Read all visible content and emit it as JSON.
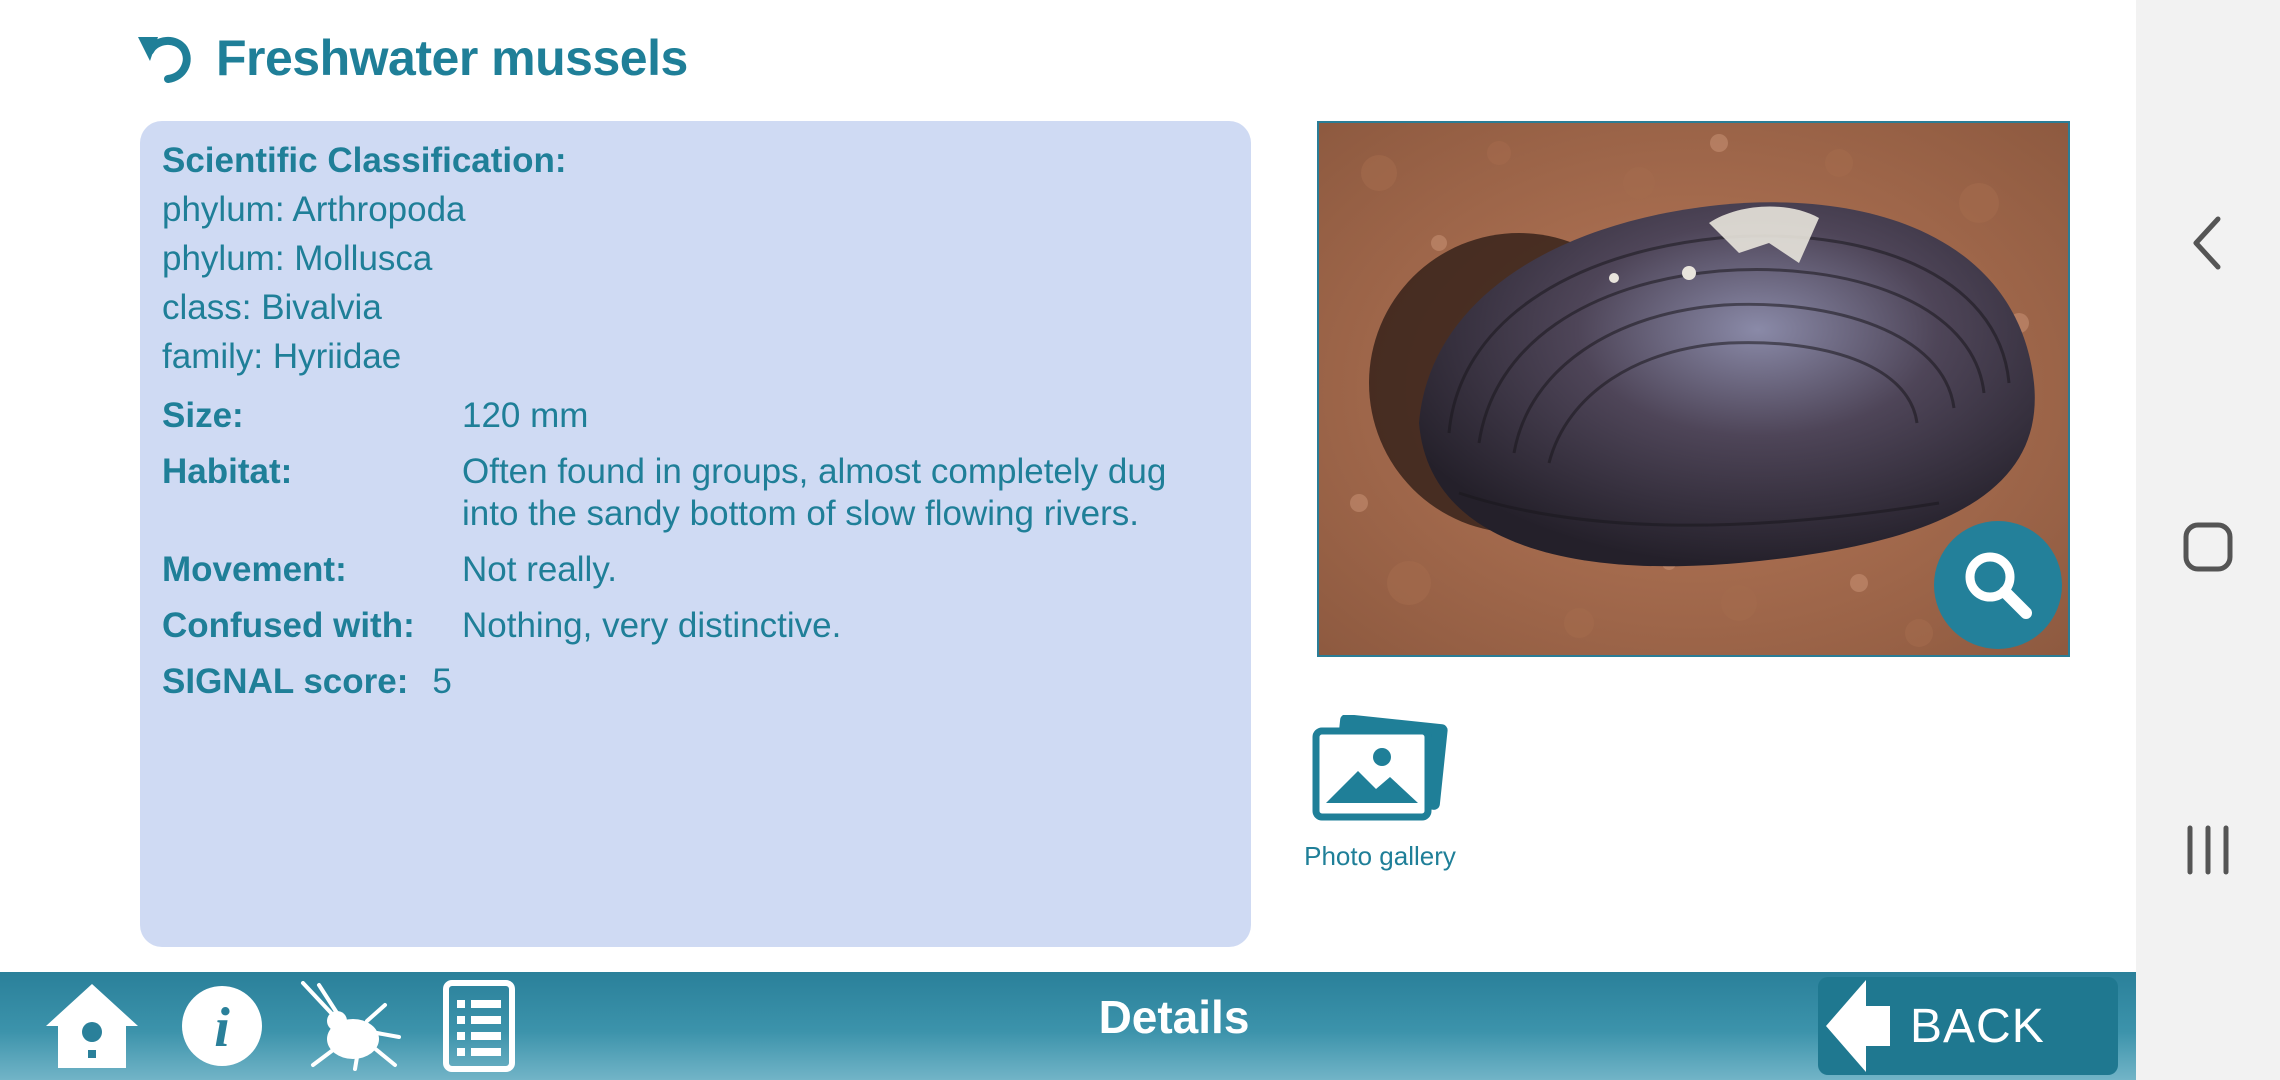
{
  "header": {
    "title": "Freshwater mussels"
  },
  "classification": {
    "title": "Scientific Classification:",
    "lines": [
      "phylum: Arthropoda",
      "phylum: Mollusca",
      "class: Bivalvia",
      "family: Hyriidae"
    ]
  },
  "details": {
    "size": {
      "label": "Size:",
      "value": "120 mm"
    },
    "habitat": {
      "label": "Habitat:",
      "value": "Often found in groups, almost completely dug into the sandy bottom of slow flowing rivers."
    },
    "movement": {
      "label": "Movement:",
      "value": "Not really."
    },
    "confused": {
      "label": "Confused with:",
      "value": "Nothing, very distinctive."
    },
    "signal": {
      "label": "SIGNAL score:",
      "value": "5"
    }
  },
  "gallery": {
    "label": "Photo gallery"
  },
  "bottombar": {
    "title": "Details",
    "back_label": "BACK"
  },
  "colors": {
    "accent": "#1f7f98",
    "card": "#cfdaf3",
    "bar": "#2a809a"
  },
  "icons": {
    "undo": "undo-icon",
    "zoom": "magnifier-icon",
    "gallery": "photo-gallery-icon",
    "home": "birdhouse-icon",
    "info": "info-icon",
    "bug": "water-bug-icon",
    "list": "checklist-icon",
    "back_arrow": "arrow-left-icon"
  }
}
